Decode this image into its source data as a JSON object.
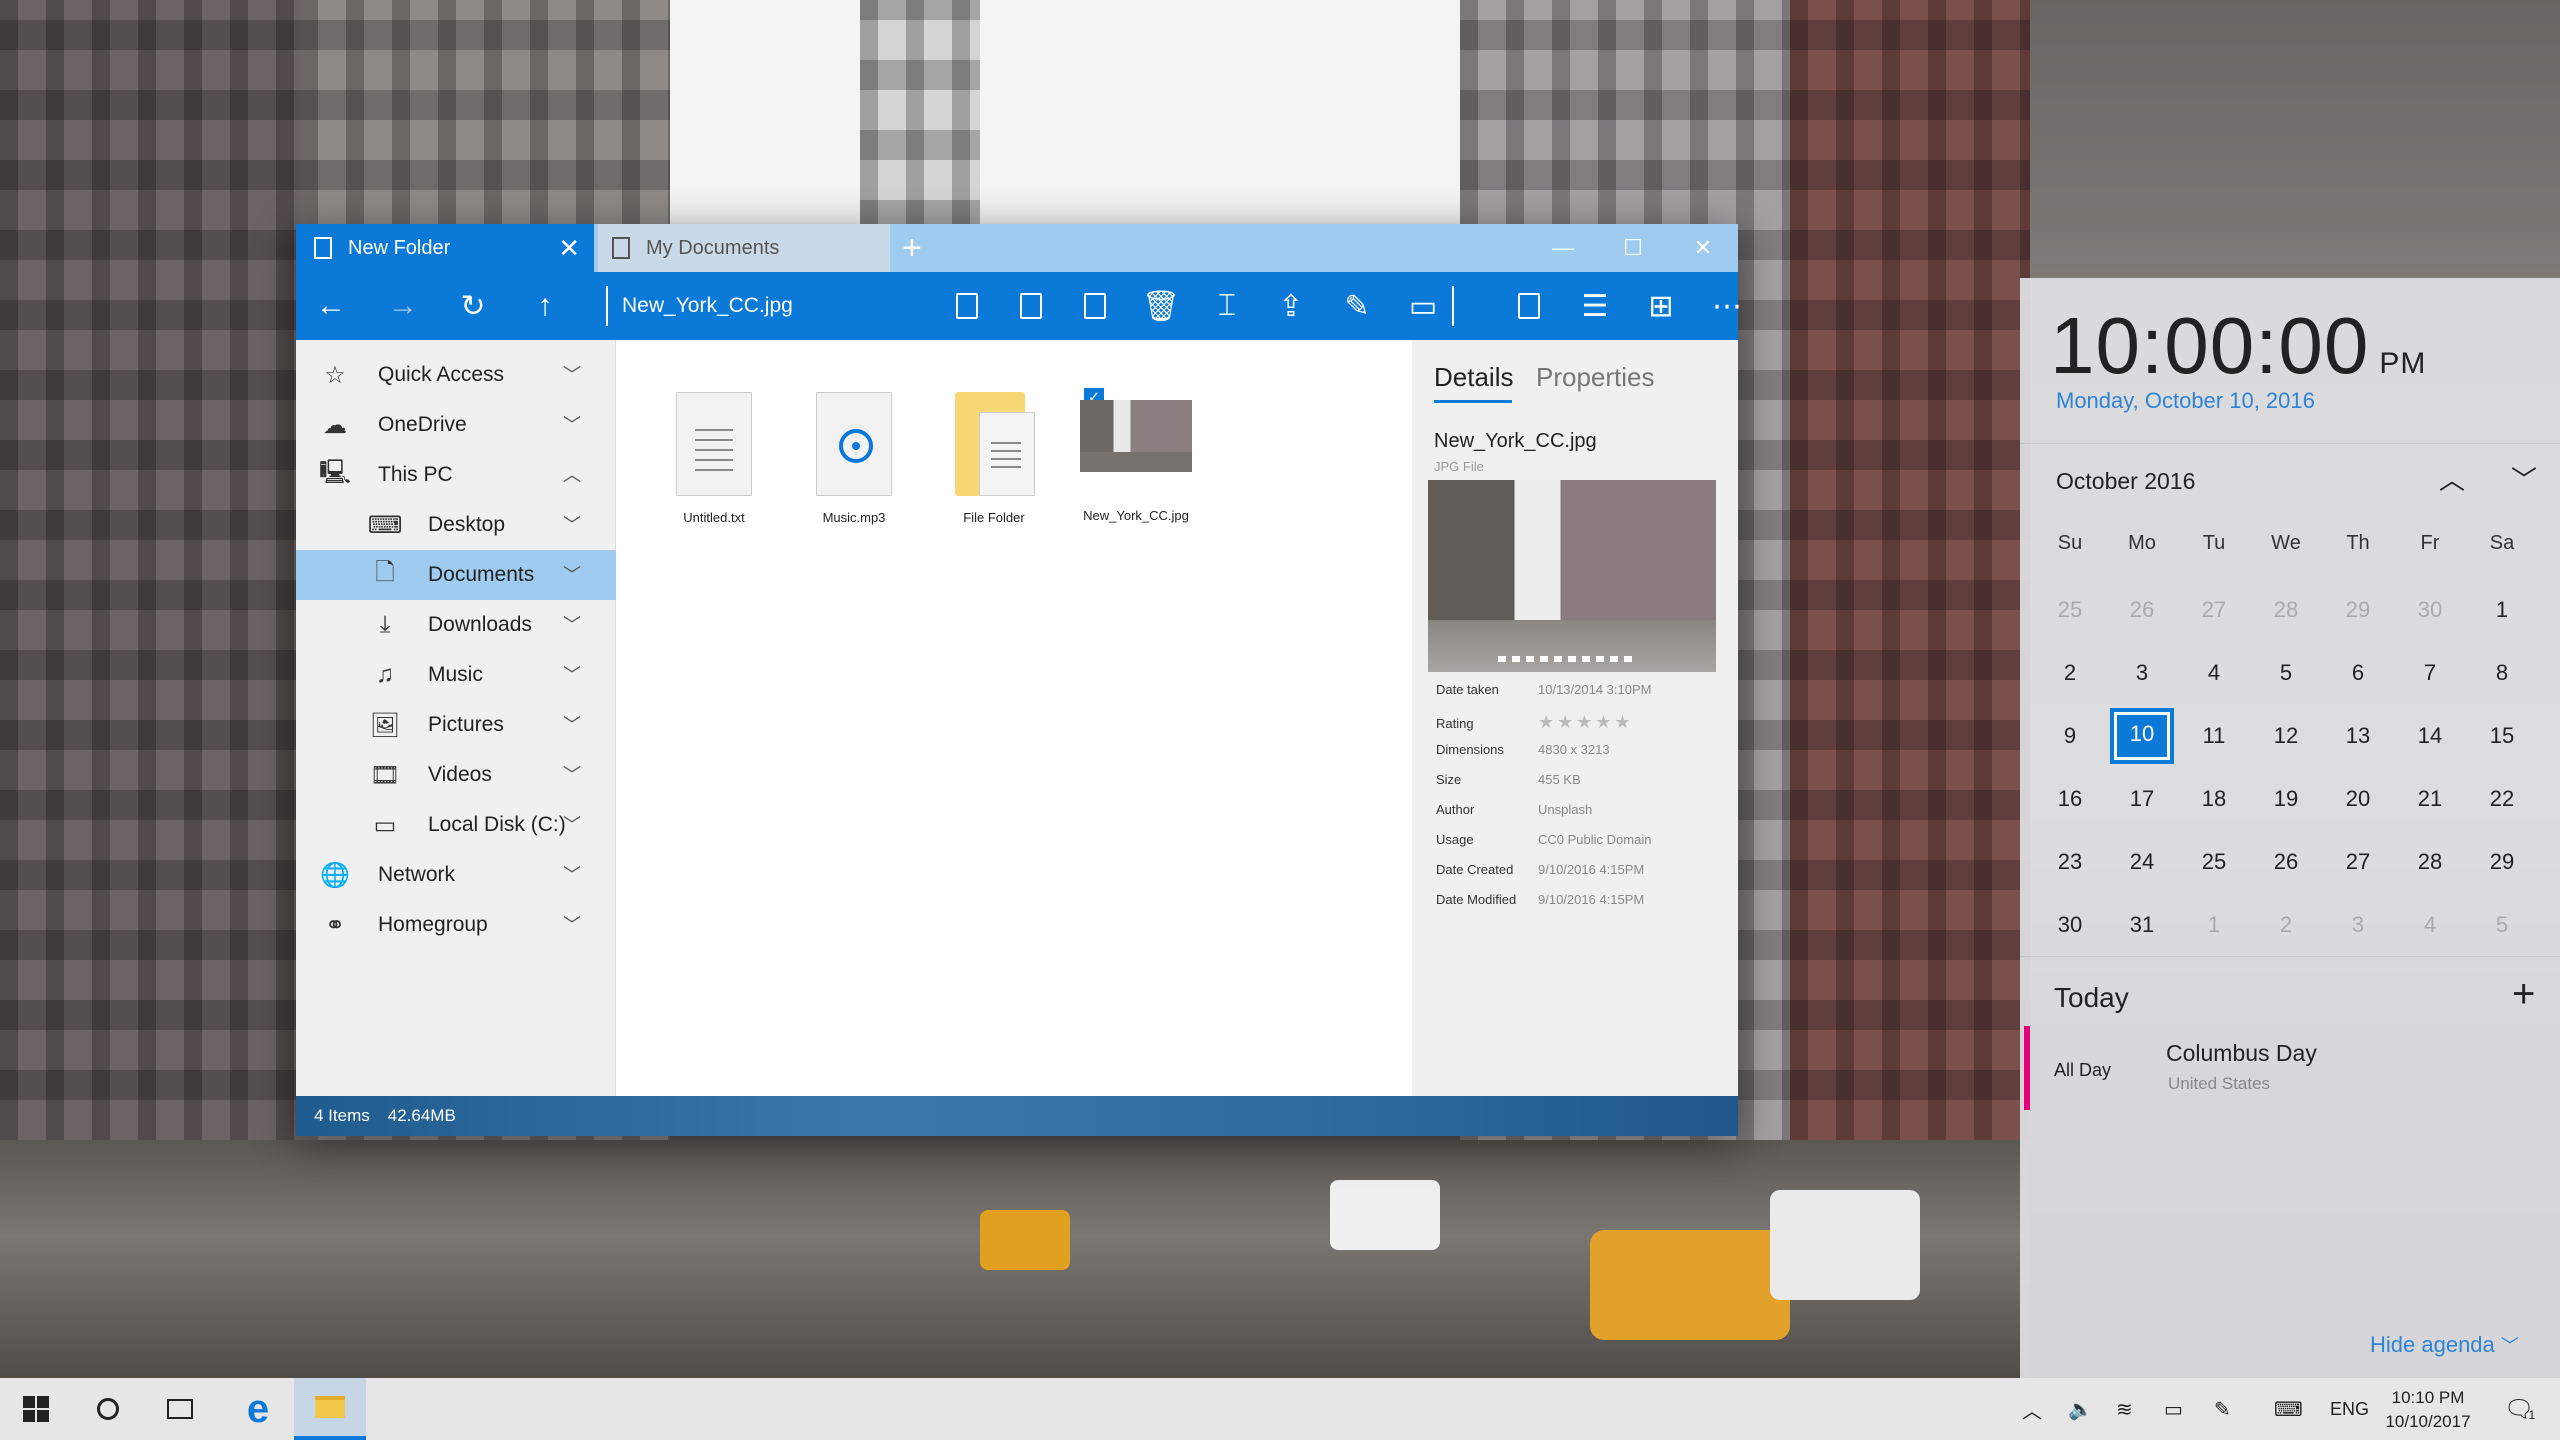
{
  "window": {
    "tabs": [
      {
        "label": "New Folder",
        "active": true
      },
      {
        "label": "My Documents",
        "active": false
      }
    ],
    "path": "New_York_CC.jpg",
    "sidebar": [
      {
        "label": "Quick Access",
        "icon": "star-list-icon",
        "level": 0,
        "expanded": false
      },
      {
        "label": "OneDrive",
        "icon": "cloud-icon",
        "level": 0,
        "expanded": false
      },
      {
        "label": "This PC",
        "icon": "computer-icon",
        "level": 0,
        "expanded": true
      },
      {
        "label": "Desktop",
        "icon": "desktop-icon",
        "level": 1,
        "expanded": false
      },
      {
        "label": "Documents",
        "icon": "document-icon",
        "level": 1,
        "expanded": false,
        "selected": true
      },
      {
        "label": "Downloads",
        "icon": "download-icon",
        "level": 1,
        "expanded": false
      },
      {
        "label": "Music",
        "icon": "music-icon",
        "level": 1,
        "expanded": false
      },
      {
        "label": "Pictures",
        "icon": "picture-icon",
        "level": 1,
        "expanded": false
      },
      {
        "label": "Videos",
        "icon": "video-icon",
        "level": 1,
        "expanded": false
      },
      {
        "label": "Local Disk (C:)",
        "icon": "disk-icon",
        "level": 1,
        "expanded": false
      },
      {
        "label": "Network",
        "icon": "network-icon",
        "level": 0,
        "expanded": false
      },
      {
        "label": "Homegroup",
        "icon": "homegroup-icon",
        "level": 0,
        "expanded": false
      }
    ],
    "files": [
      {
        "name": "Untitled.txt",
        "type": "text"
      },
      {
        "name": "Music.mp3",
        "type": "audio"
      },
      {
        "name": "File Folder",
        "type": "folder"
      },
      {
        "name": "New_York_CC.jpg",
        "type": "image",
        "checked": true
      }
    ],
    "details": {
      "tab_details": "Details",
      "tab_properties": "Properties",
      "filename": "New_York_CC.jpg",
      "filetype": "JPG File",
      "rows": [
        {
          "k": "Date taken",
          "v": "10/13/2014 3:10PM"
        },
        {
          "k": "Rating",
          "v": "★★★★★"
        },
        {
          "k": "Dimensions",
          "v": "4830 x 3213"
        },
        {
          "k": "Size",
          "v": "455 KB"
        },
        {
          "k": "Author",
          "v": "Unsplash"
        },
        {
          "k": "Usage",
          "v": "CC0 Public Domain"
        },
        {
          "k": "Date Created",
          "v": "9/10/2016 4:15PM"
        },
        {
          "k": "Date Modified",
          "v": "9/10/2016 4:15PM"
        }
      ]
    },
    "status": {
      "items": "4 Items",
      "size": "42.64MB"
    }
  },
  "calendar": {
    "time": "10:00:00",
    "ampm": "PM",
    "date": "Monday, October  10, 2016",
    "month": "October 2016",
    "dow": [
      "Su",
      "Mo",
      "Tu",
      "We",
      "Th",
      "Fr",
      "Sa"
    ],
    "weeks": [
      [
        "25",
        "26",
        "27",
        "28",
        "29",
        "30",
        "1"
      ],
      [
        "2",
        "3",
        "4",
        "5",
        "6",
        "7",
        "8"
      ],
      [
        "9",
        "10",
        "11",
        "12",
        "13",
        "14",
        "15"
      ],
      [
        "16",
        "17",
        "18",
        "19",
        "20",
        "21",
        "22"
      ],
      [
        "23",
        "24",
        "25",
        "26",
        "27",
        "28",
        "29"
      ],
      [
        "30",
        "31",
        "1",
        "2",
        "3",
        "4",
        "5"
      ]
    ],
    "selected_day": "10",
    "today_label": "Today",
    "event": {
      "when": "All Day",
      "title": "Columbus Day",
      "sub": "United States",
      "color": "#e3007a"
    },
    "hide_label": "Hide agenda"
  },
  "taskbar": {
    "lang": "ENG",
    "time": "10:10 PM",
    "date": "10/10/2017",
    "notif_count": "1"
  },
  "colors": {
    "accent": "#0a79d8",
    "tab_bar": "#9fcbf0",
    "selected": "#9fcbf0"
  }
}
